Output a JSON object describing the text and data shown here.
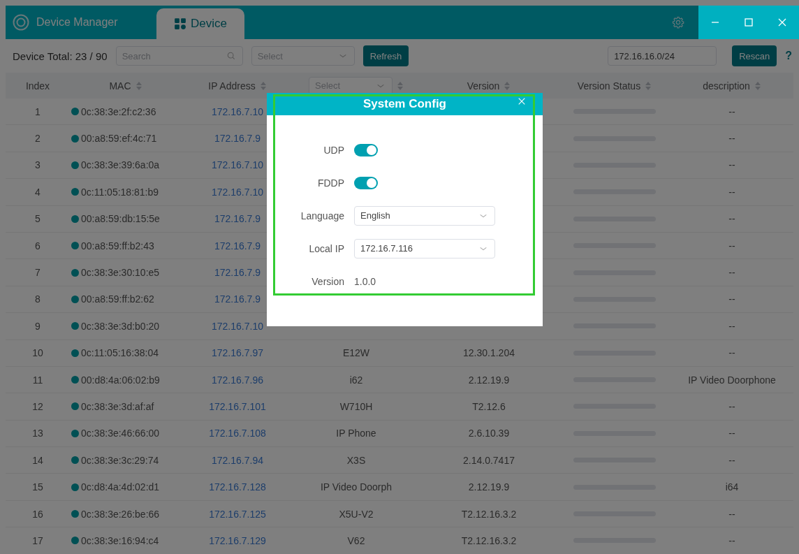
{
  "app": {
    "title": "Device Manager"
  },
  "tabs": [
    {
      "label": "Device",
      "selected": true
    }
  ],
  "toolbar": {
    "total": "Device Total: 23 / 90",
    "search": {
      "placeholder": "Search"
    },
    "filter": {
      "placeholder": "Select"
    },
    "refresh": "Refresh",
    "subnet": {
      "value": "172.16.16.0/24"
    },
    "rescan": "Rescan",
    "help": "?"
  },
  "table": {
    "columns": [
      {
        "label": "Index",
        "kind": "text"
      },
      {
        "label": "MAC",
        "kind": "sort"
      },
      {
        "label": "IP Address",
        "kind": "sort"
      },
      {
        "placeholder": "Select",
        "kind": "select"
      },
      {
        "label": "Version",
        "kind": "sort"
      },
      {
        "label": "Version Status",
        "kind": "sort"
      },
      {
        "label": "description",
        "kind": "sort"
      }
    ],
    "rows": [
      {
        "index": "1",
        "mac": "0c:38:3e:2f:c2:36",
        "online": true,
        "ip": "172.16.7.10",
        "description": "--"
      },
      {
        "index": "2",
        "mac": "00:a8:59:ef:4c:71",
        "online": true,
        "ip": "172.16.7.9",
        "description": "--"
      },
      {
        "index": "3",
        "mac": "0c:38:3e:39:6a:0a",
        "online": true,
        "ip": "172.16.7.10",
        "description": "--"
      },
      {
        "index": "4",
        "mac": "0c:11:05:18:81:b9",
        "online": true,
        "ip": "172.16.7.10",
        "description": "--"
      },
      {
        "index": "5",
        "mac": "00:a8:59:db:15:5e",
        "online": true,
        "ip": "172.16.7.9",
        "description": "--"
      },
      {
        "index": "6",
        "mac": "00:a8:59:ff:b2:43",
        "online": true,
        "ip": "172.16.7.9",
        "description": "--"
      },
      {
        "index": "7",
        "mac": "0c:38:3e:30:10:e5",
        "online": true,
        "ip": "172.16.7.9",
        "description": "--"
      },
      {
        "index": "8",
        "mac": "00:a8:59:ff:b2:62",
        "online": true,
        "ip": "172.16.7.9",
        "description": "--"
      },
      {
        "index": "9",
        "mac": "0c:38:3e:3d:b0:20",
        "online": true,
        "ip": "172.16.7.10",
        "description": "--"
      },
      {
        "index": "10",
        "mac": "0c:11:05:16:38:04",
        "online": true,
        "ip": "172.16.7.97",
        "model": "E12W",
        "version": "12.30.1.204",
        "description": "--"
      },
      {
        "index": "11",
        "mac": "00:d8:4a:06:02:b9",
        "online": true,
        "ip": "172.16.7.96",
        "model": "i62",
        "version": "2.12.19.9",
        "description": "IP Video Doorphone"
      },
      {
        "index": "12",
        "mac": "0c:38:3e:3d:af:af",
        "online": true,
        "ip": "172.16.7.101",
        "model": "W710H",
        "version": "T2.12.6",
        "description": "--"
      },
      {
        "index": "13",
        "mac": "0c:38:3e:46:66:00",
        "online": true,
        "ip": "172.16.7.108",
        "model": "IP Phone",
        "version": "2.6.10.39",
        "description": "--"
      },
      {
        "index": "14",
        "mac": "0c:38:3e:3c:29:74",
        "online": true,
        "ip": "172.16.7.94",
        "model": "X3S",
        "version": "2.14.0.7417",
        "description": "--"
      },
      {
        "index": "15",
        "mac": "0c:d8:4a:4d:02:d1",
        "online": true,
        "ip": "172.16.7.128",
        "model": "IP Video Doorph",
        "version": "2.12.19.9",
        "description": "i64"
      },
      {
        "index": "16",
        "mac": "0c:38:3e:26:be:66",
        "online": true,
        "ip": "172.16.7.125",
        "model": "X5U-V2",
        "version": "T2.12.16.3.2",
        "description": "--"
      },
      {
        "index": "17",
        "mac": "0c:38:3e:16:94:c4",
        "online": true,
        "ip": "172.16.7.129",
        "model": "V62",
        "version": "T2.12.16.3.2",
        "description": "--"
      }
    ]
  },
  "dialog": {
    "title": "System Config",
    "fields": [
      {
        "kind": "toggle",
        "label": "UDP",
        "on": true
      },
      {
        "kind": "toggle",
        "label": "FDDP",
        "on": true
      },
      {
        "kind": "select",
        "label": "Language",
        "value": "English"
      },
      {
        "kind": "select",
        "label": "Local IP",
        "value": "172.16.7.116"
      },
      {
        "kind": "text",
        "label": "Version",
        "value": "1.0.0"
      }
    ]
  }
}
